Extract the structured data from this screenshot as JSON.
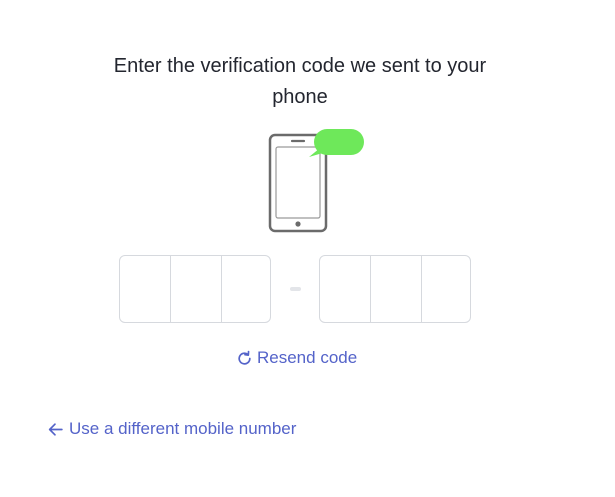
{
  "heading": "Enter the verification code we sent to your phone",
  "illustration": {
    "phone_icon": "smartphone-icon",
    "bubble_icon": "message-bubble-icon",
    "bubble_color": "#6ee85a",
    "phone_color": "#6b6b6b"
  },
  "code": {
    "first_group": [
      "",
      "",
      ""
    ],
    "second_group": [
      "",
      "",
      ""
    ],
    "separator": "-"
  },
  "resend": {
    "icon": "refresh-icon",
    "label": "Resend code"
  },
  "back_link": {
    "icon": "arrow-left-icon",
    "label": "Use a different mobile number"
  },
  "colors": {
    "link": "#5463c9",
    "input_border": "#d6d9de",
    "heading": "#23262f"
  }
}
